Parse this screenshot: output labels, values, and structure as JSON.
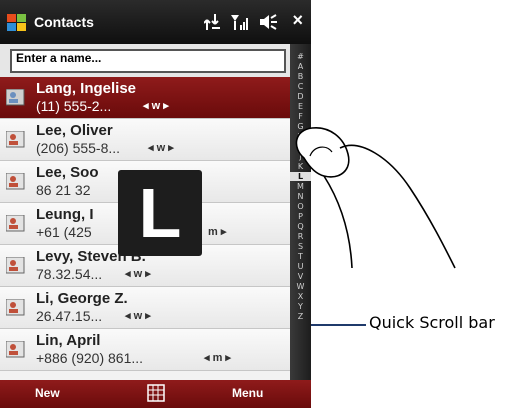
{
  "titlebar": {
    "title": "Contacts",
    "close": "×"
  },
  "search": {
    "value": "Enter a name..."
  },
  "contacts": [
    {
      "name": "Lang, Ingelise",
      "phone": "(11) 555-2...",
      "tag": "◂ w ▸",
      "selected": true
    },
    {
      "name": "Lee, Oliver",
      "phone": "(206) 555-8...",
      "tag": "◂ w ▸"
    },
    {
      "name": "Lee, Soo",
      "phone": "86 21 32"
    },
    {
      "name": "Leung, I",
      "phone": "+61 (425",
      "tag": "m ▸"
    },
    {
      "name": "Levy, Steven B.",
      "phone": "78.32.54...",
      "tag": "◂ w ▸"
    },
    {
      "name": "Li, George Z.",
      "phone": "26.47.15...",
      "tag": "◂ w ▸"
    },
    {
      "name": "Lin, April",
      "phone": "+886 (920) 861...",
      "tag": "◂ m ▸"
    }
  ],
  "index_letters": [
    "#",
    "A",
    "B",
    "C",
    "D",
    "E",
    "F",
    "G",
    "H",
    "I",
    "J",
    "K",
    "L",
    "M",
    "N",
    "O",
    "P",
    "Q",
    "R",
    "S",
    "T",
    "U",
    "V",
    "W",
    "X",
    "Y",
    "Z"
  ],
  "active_letter": "L",
  "popup_letter": "L",
  "softkeys": {
    "left": "New",
    "right": "Menu"
  },
  "annotation": {
    "label": "Quick Scroll bar"
  },
  "colors": {
    "accent": "#7a1212",
    "title_bg": "#1a1a1a",
    "callout": "#1f3a6b"
  }
}
